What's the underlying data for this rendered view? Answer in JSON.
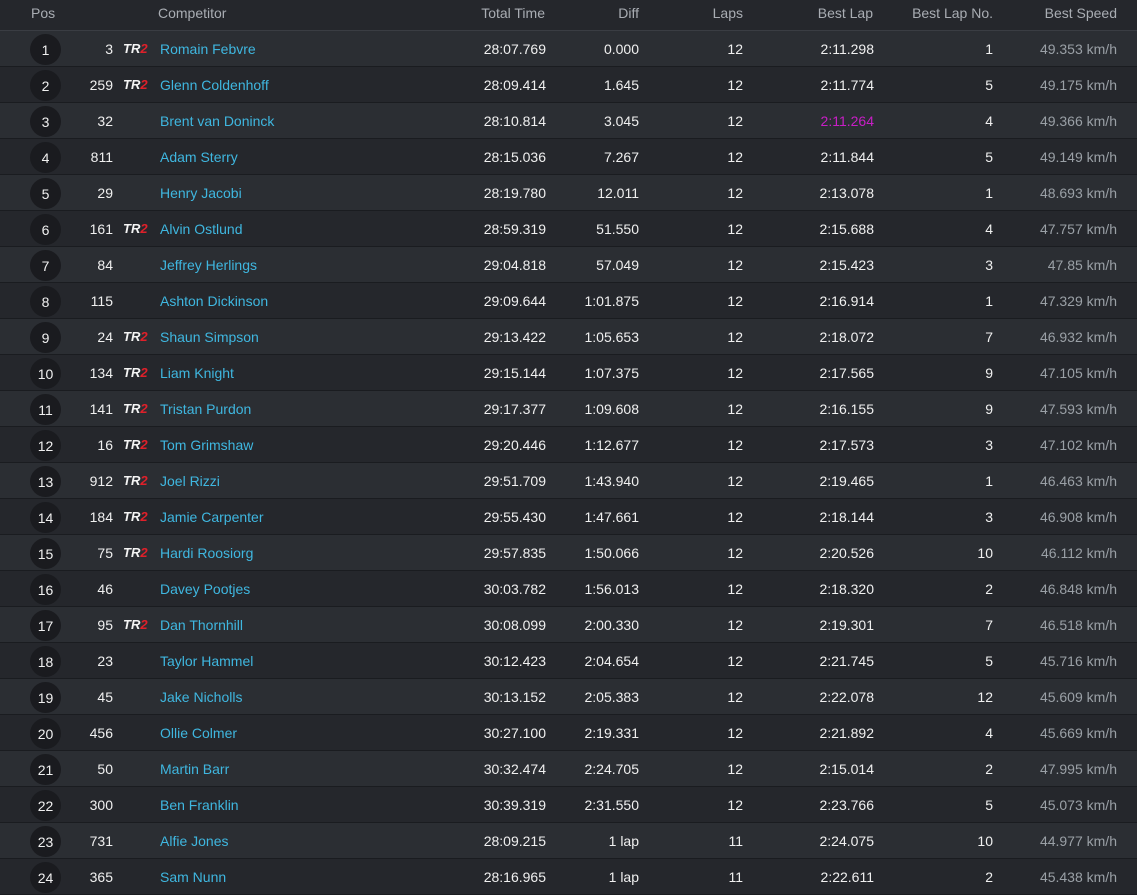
{
  "header": {
    "pos": "Pos",
    "competitor": "Competitor",
    "total_time": "Total Time",
    "diff": "Diff",
    "laps": "Laps",
    "best_lap": "Best Lap",
    "best_lap_no": "Best Lap No.",
    "best_speed": "Best Speed"
  },
  "badge": {
    "tr": "TR",
    "two": "2"
  },
  "colors": {
    "accent_name": "#3fb7e0",
    "fastest_lap": "#c81ec6",
    "badge_red": "#e0202a"
  },
  "rows": [
    {
      "pos": "1",
      "num": "3",
      "tr2": true,
      "name": "Romain Febvre",
      "total": "28:07.769",
      "diff": "0.000",
      "laps": "12",
      "best": "2:11.298",
      "bestno": "1",
      "speed": "49.353 km/h",
      "fastest": false
    },
    {
      "pos": "2",
      "num": "259",
      "tr2": true,
      "name": "Glenn Coldenhoff",
      "total": "28:09.414",
      "diff": "1.645",
      "laps": "12",
      "best": "2:11.774",
      "bestno": "5",
      "speed": "49.175 km/h",
      "fastest": false
    },
    {
      "pos": "3",
      "num": "32",
      "tr2": false,
      "name": "Brent van Doninck",
      "total": "28:10.814",
      "diff": "3.045",
      "laps": "12",
      "best": "2:11.264",
      "bestno": "4",
      "speed": "49.366 km/h",
      "fastest": true
    },
    {
      "pos": "4",
      "num": "811",
      "tr2": false,
      "name": "Adam Sterry",
      "total": "28:15.036",
      "diff": "7.267",
      "laps": "12",
      "best": "2:11.844",
      "bestno": "5",
      "speed": "49.149 km/h",
      "fastest": false
    },
    {
      "pos": "5",
      "num": "29",
      "tr2": false,
      "name": "Henry Jacobi",
      "total": "28:19.780",
      "diff": "12.011",
      "laps": "12",
      "best": "2:13.078",
      "bestno": "1",
      "speed": "48.693 km/h",
      "fastest": false
    },
    {
      "pos": "6",
      "num": "161",
      "tr2": true,
      "name": "Alvin Ostlund",
      "total": "28:59.319",
      "diff": "51.550",
      "laps": "12",
      "best": "2:15.688",
      "bestno": "4",
      "speed": "47.757 km/h",
      "fastest": false
    },
    {
      "pos": "7",
      "num": "84",
      "tr2": false,
      "name": "Jeffrey Herlings",
      "total": "29:04.818",
      "diff": "57.049",
      "laps": "12",
      "best": "2:15.423",
      "bestno": "3",
      "speed": "47.85 km/h",
      "fastest": false
    },
    {
      "pos": "8",
      "num": "115",
      "tr2": false,
      "name": "Ashton Dickinson",
      "total": "29:09.644",
      "diff": "1:01.875",
      "laps": "12",
      "best": "2:16.914",
      "bestno": "1",
      "speed": "47.329 km/h",
      "fastest": false
    },
    {
      "pos": "9",
      "num": "24",
      "tr2": true,
      "name": "Shaun Simpson",
      "total": "29:13.422",
      "diff": "1:05.653",
      "laps": "12",
      "best": "2:18.072",
      "bestno": "7",
      "speed": "46.932 km/h",
      "fastest": false
    },
    {
      "pos": "10",
      "num": "134",
      "tr2": true,
      "name": "Liam Knight",
      "total": "29:15.144",
      "diff": "1:07.375",
      "laps": "12",
      "best": "2:17.565",
      "bestno": "9",
      "speed": "47.105 km/h",
      "fastest": false
    },
    {
      "pos": "11",
      "num": "141",
      "tr2": true,
      "name": "Tristan Purdon",
      "total": "29:17.377",
      "diff": "1:09.608",
      "laps": "12",
      "best": "2:16.155",
      "bestno": "9",
      "speed": "47.593 km/h",
      "fastest": false
    },
    {
      "pos": "12",
      "num": "16",
      "tr2": true,
      "name": "Tom Grimshaw",
      "total": "29:20.446",
      "diff": "1:12.677",
      "laps": "12",
      "best": "2:17.573",
      "bestno": "3",
      "speed": "47.102 km/h",
      "fastest": false
    },
    {
      "pos": "13",
      "num": "912",
      "tr2": true,
      "name": "Joel Rizzi",
      "total": "29:51.709",
      "diff": "1:43.940",
      "laps": "12",
      "best": "2:19.465",
      "bestno": "1",
      "speed": "46.463 km/h",
      "fastest": false
    },
    {
      "pos": "14",
      "num": "184",
      "tr2": true,
      "name": "Jamie Carpenter",
      "total": "29:55.430",
      "diff": "1:47.661",
      "laps": "12",
      "best": "2:18.144",
      "bestno": "3",
      "speed": "46.908 km/h",
      "fastest": false
    },
    {
      "pos": "15",
      "num": "75",
      "tr2": true,
      "name": "Hardi Roosiorg",
      "total": "29:57.835",
      "diff": "1:50.066",
      "laps": "12",
      "best": "2:20.526",
      "bestno": "10",
      "speed": "46.112 km/h",
      "fastest": false
    },
    {
      "pos": "16",
      "num": "46",
      "tr2": false,
      "name": "Davey Pootjes",
      "total": "30:03.782",
      "diff": "1:56.013",
      "laps": "12",
      "best": "2:18.320",
      "bestno": "2",
      "speed": "46.848 km/h",
      "fastest": false
    },
    {
      "pos": "17",
      "num": "95",
      "tr2": true,
      "name": "Dan Thornhill",
      "total": "30:08.099",
      "diff": "2:00.330",
      "laps": "12",
      "best": "2:19.301",
      "bestno": "7",
      "speed": "46.518 km/h",
      "fastest": false
    },
    {
      "pos": "18",
      "num": "23",
      "tr2": false,
      "name": "Taylor Hammel",
      "total": "30:12.423",
      "diff": "2:04.654",
      "laps": "12",
      "best": "2:21.745",
      "bestno": "5",
      "speed": "45.716 km/h",
      "fastest": false
    },
    {
      "pos": "19",
      "num": "45",
      "tr2": false,
      "name": "Jake Nicholls",
      "total": "30:13.152",
      "diff": "2:05.383",
      "laps": "12",
      "best": "2:22.078",
      "bestno": "12",
      "speed": "45.609 km/h",
      "fastest": false
    },
    {
      "pos": "20",
      "num": "456",
      "tr2": false,
      "name": "Ollie Colmer",
      "total": "30:27.100",
      "diff": "2:19.331",
      "laps": "12",
      "best": "2:21.892",
      "bestno": "4",
      "speed": "45.669 km/h",
      "fastest": false
    },
    {
      "pos": "21",
      "num": "50",
      "tr2": false,
      "name": "Martin Barr",
      "total": "30:32.474",
      "diff": "2:24.705",
      "laps": "12",
      "best": "2:15.014",
      "bestno": "2",
      "speed": "47.995 km/h",
      "fastest": false
    },
    {
      "pos": "22",
      "num": "300",
      "tr2": false,
      "name": "Ben Franklin",
      "total": "30:39.319",
      "diff": "2:31.550",
      "laps": "12",
      "best": "2:23.766",
      "bestno": "5",
      "speed": "45.073 km/h",
      "fastest": false
    },
    {
      "pos": "23",
      "num": "731",
      "tr2": false,
      "name": "Alfie Jones",
      "total": "28:09.215",
      "diff": "1 lap",
      "laps": "11",
      "best": "2:24.075",
      "bestno": "10",
      "speed": "44.977 km/h",
      "fastest": false
    },
    {
      "pos": "24",
      "num": "365",
      "tr2": false,
      "name": "Sam Nunn",
      "total": "28:16.965",
      "diff": "1 lap",
      "laps": "11",
      "best": "2:22.611",
      "bestno": "2",
      "speed": "45.438 km/h",
      "fastest": false
    }
  ]
}
